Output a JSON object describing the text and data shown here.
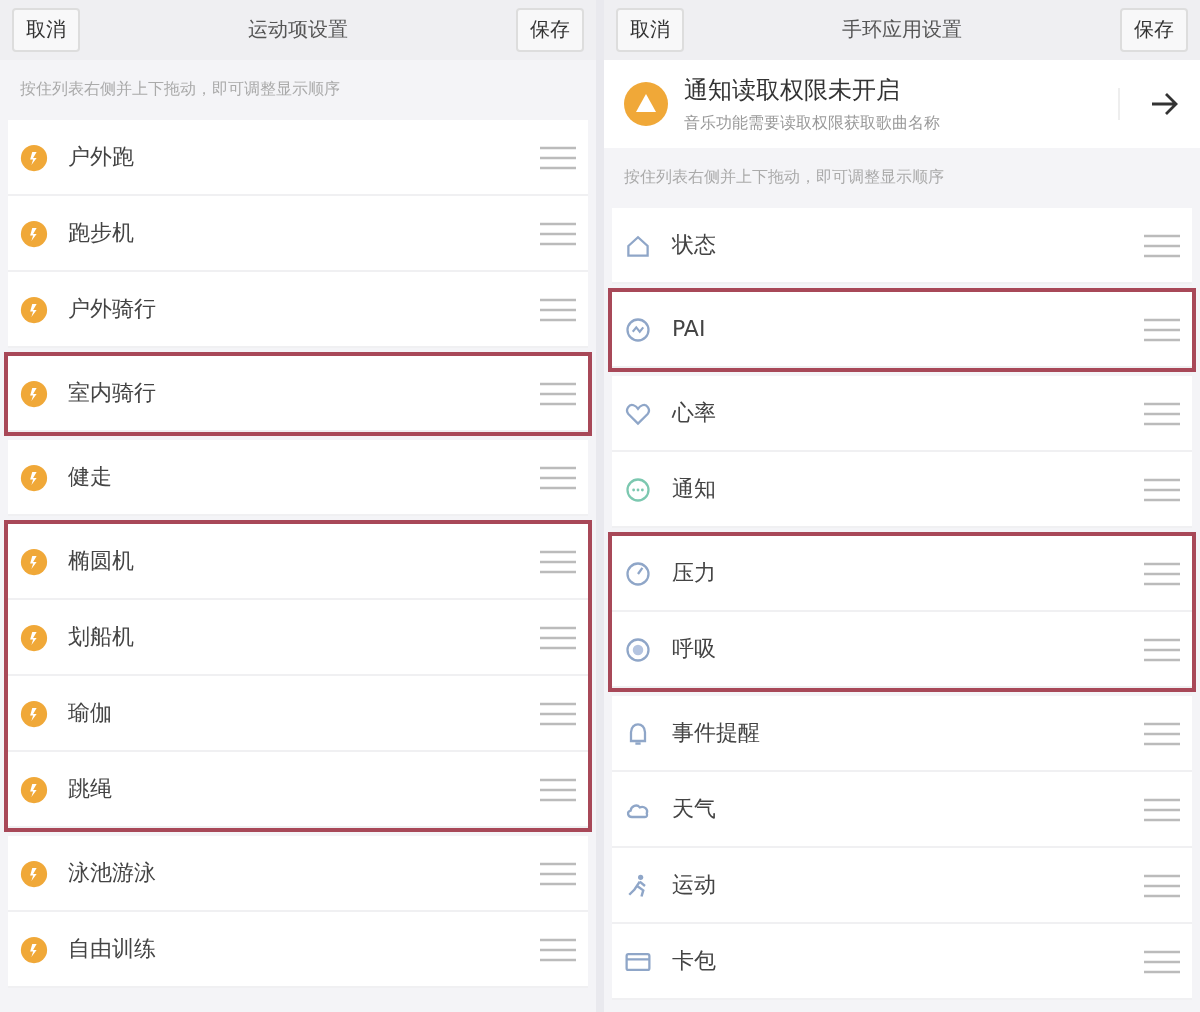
{
  "panels": [
    {
      "header": {
        "cancel": "取消",
        "title": "运动项设置",
        "save": "保存"
      },
      "hint": "按住列表右侧并上下拖动，即可调整显示顺序",
      "sections": [
        {
          "highlighted": false,
          "items": [
            {
              "label": "户外跑",
              "kind": "sport"
            },
            {
              "label": "跑步机",
              "kind": "sport"
            },
            {
              "label": "户外骑行",
              "kind": "sport"
            }
          ]
        },
        {
          "highlighted": true,
          "items": [
            {
              "label": "室内骑行",
              "kind": "sport"
            }
          ]
        },
        {
          "highlighted": false,
          "items": [
            {
              "label": "健走",
              "kind": "sport"
            }
          ]
        },
        {
          "highlighted": true,
          "items": [
            {
              "label": "椭圆机",
              "kind": "sport"
            },
            {
              "label": "划船机",
              "kind": "sport"
            },
            {
              "label": "瑜伽",
              "kind": "sport"
            },
            {
              "label": "跳绳",
              "kind": "sport"
            }
          ]
        },
        {
          "highlighted": false,
          "items": [
            {
              "label": "泳池游泳",
              "kind": "sport"
            },
            {
              "label": "自由训练",
              "kind": "sport"
            }
          ]
        }
      ]
    },
    {
      "header": {
        "cancel": "取消",
        "title": "手环应用设置",
        "save": "保存"
      },
      "banner": {
        "title": "通知读取权限未开启",
        "subtitle": "音乐功能需要读取权限获取歌曲名称"
      },
      "hint": "按住列表右侧并上下拖动，即可调整显示顺序",
      "sections": [
        {
          "highlighted": false,
          "items": [
            {
              "label": "状态",
              "kind": "home"
            }
          ]
        },
        {
          "highlighted": true,
          "items": [
            {
              "label": "PAI",
              "kind": "pai"
            }
          ]
        },
        {
          "highlighted": false,
          "items": [
            {
              "label": "心率",
              "kind": "heart"
            },
            {
              "label": "通知",
              "kind": "chat"
            }
          ]
        },
        {
          "highlighted": true,
          "items": [
            {
              "label": "压力",
              "kind": "gauge"
            },
            {
              "label": "呼吸",
              "kind": "breath"
            }
          ]
        },
        {
          "highlighted": false,
          "items": [
            {
              "label": "事件提醒",
              "kind": "bell"
            },
            {
              "label": "天气",
              "kind": "cloud"
            },
            {
              "label": "运动",
              "kind": "run"
            },
            {
              "label": "卡包",
              "kind": "card"
            }
          ]
        }
      ]
    }
  ]
}
